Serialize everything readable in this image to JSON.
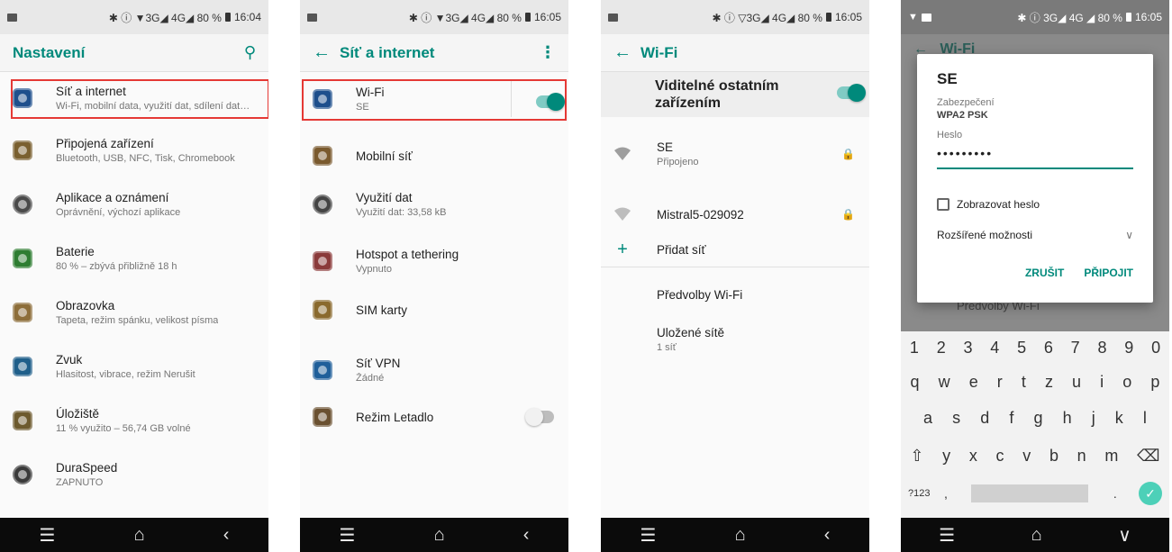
{
  "status": {
    "s1": {
      "indicators": "✱ ⓘ ▼3G◢ 4G◢ 80 %",
      "time": "16:04"
    },
    "s2": {
      "indicators": "✱ ⓘ ▼3G◢ 4G◢ 80 %",
      "time": "16:05"
    },
    "s3": {
      "indicators": "✱ ⓘ ▽3G◢ 4G◢ 80 %",
      "time": "16:05"
    },
    "s4": {
      "indicators": "✱ ⓘ 3G◢ 4G ◢ 80 %",
      "time": "16:05"
    }
  },
  "screen1": {
    "title": "Nastavení",
    "items": [
      {
        "title": "Síť a internet",
        "subtitle": "Wi-Fi, mobilní data, využití dat, sdílení dat…",
        "color": "#1e4f8c"
      },
      {
        "title": "Připojená zařízení",
        "subtitle": "Bluetooth, USB, NFC, Tisk, Chromebook",
        "color": "#7a6030"
      },
      {
        "title": "Aplikace a oznámení",
        "subtitle": "Oprávnění, výchozí aplikace",
        "color": "#4a4a4a"
      },
      {
        "title": "Baterie",
        "subtitle": "80 % – zbývá přibližně 18 h",
        "color": "#2e7d32"
      },
      {
        "title": "Obrazovka",
        "subtitle": "Tapeta, režim spánku, velikost písma",
        "color": "#8d6e3a"
      },
      {
        "title": "Zvuk",
        "subtitle": "Hlasitost, vibrace, režim Nerušit",
        "color": "#1f5f8a"
      },
      {
        "title": "Úložiště",
        "subtitle": "11 % využito – 56,74 GB volné",
        "color": "#6d5a2e"
      },
      {
        "title": "DuraSpeed",
        "subtitle": "ZAPNUTO",
        "color": "#3a3a3a"
      }
    ]
  },
  "screen2": {
    "title": "Síť a internet",
    "items": [
      {
        "title": "Wi-Fi",
        "subtitle": "SE",
        "color": "#1e4f8c"
      },
      {
        "title": "Mobilní síť",
        "subtitle": "",
        "color": "#7a5a2e"
      },
      {
        "title": "Využití dat",
        "subtitle": "Využití dat: 33,58 kB",
        "color": "#444"
      },
      {
        "title": "Hotspot a tethering",
        "subtitle": "Vypnuto",
        "color": "#8a3a3a"
      },
      {
        "title": "SIM karty",
        "subtitle": "",
        "color": "#8a6a2e"
      },
      {
        "title": "Síť VPN",
        "subtitle": "Žádné",
        "color": "#1f5f9a"
      },
      {
        "title": "Režim Letadlo",
        "subtitle": "",
        "color": "#6a5030"
      }
    ],
    "wifi_on": true,
    "airplane_on": false
  },
  "screen3": {
    "title": "Wi-Fi",
    "visible_label": "Viditelné ostatním zařízením",
    "networks": [
      {
        "name": "SE",
        "status": "Připojeno"
      },
      {
        "name": "Mistral5-029092",
        "status": ""
      }
    ],
    "add_network": "Přidat síť",
    "prefs": "Předvolby Wi-Fi",
    "saved": "Uložené sítě",
    "saved_count": "1 síť"
  },
  "screen4": {
    "bg_title": "Wi-Fi",
    "bg_text": "Předvolby Wi-Fi",
    "dialog": {
      "ssid": "SE",
      "security_label": "Zabezpečení",
      "security_value": "WPA2 PSK",
      "password_label": "Heslo",
      "password_value": "•••••••••",
      "show_password": "Zobrazovat heslo",
      "advanced": "Rozšířené možnosti",
      "cancel": "ZRUŠIT",
      "connect": "PŘIPOJIT"
    },
    "keyboard": {
      "numbers": [
        "1",
        "2",
        "3",
        "4",
        "5",
        "6",
        "7",
        "8",
        "9",
        "0"
      ],
      "row1": [
        "q",
        "w",
        "e",
        "r",
        "t",
        "z",
        "u",
        "i",
        "o",
        "p"
      ],
      "row2": [
        "a",
        "s",
        "d",
        "f",
        "g",
        "h",
        "j",
        "k",
        "l"
      ],
      "row3": [
        "y",
        "x",
        "c",
        "v",
        "b",
        "n",
        "m"
      ],
      "sym": "?123",
      "comma": ",",
      "period": "."
    }
  },
  "nav": {
    "menu": "☰",
    "home": "⌂",
    "back": "‹",
    "down": "∨"
  }
}
